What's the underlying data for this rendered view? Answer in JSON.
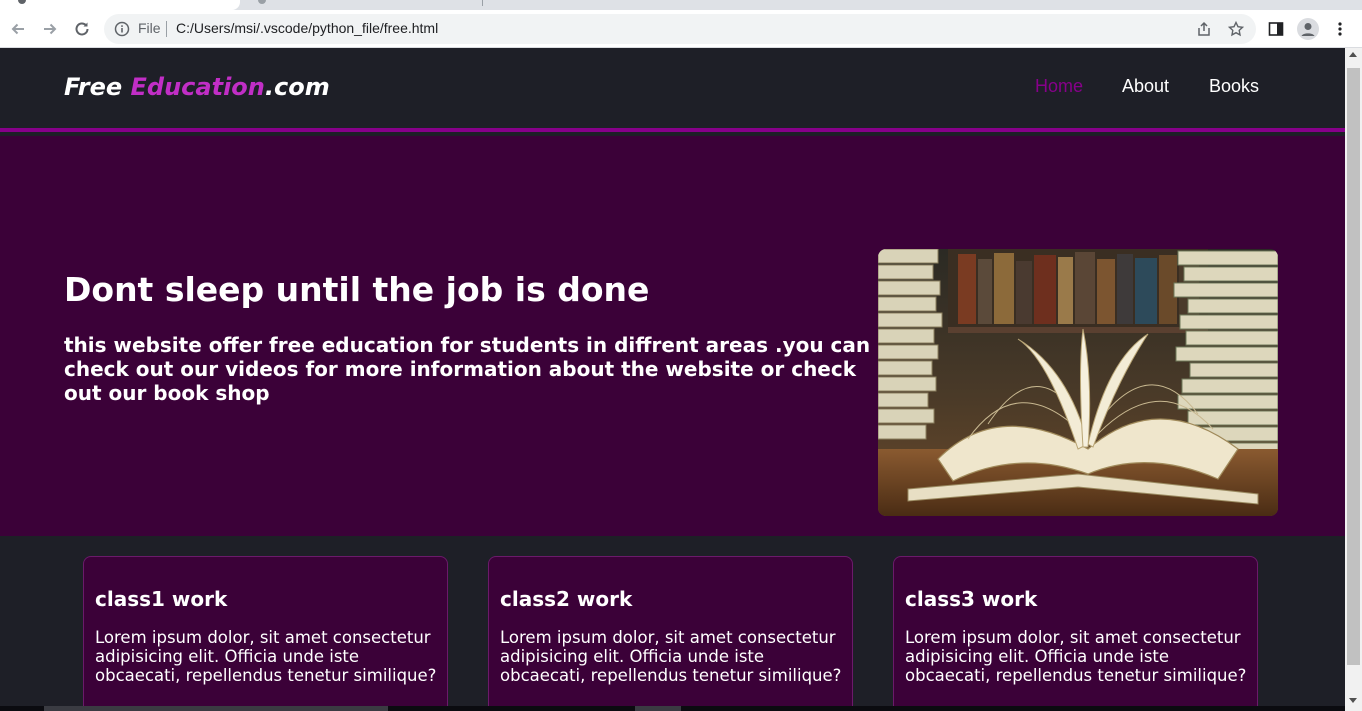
{
  "browser": {
    "address_scheme": "File",
    "address_url": "C:/Users/msi/.vscode/python_file/free.html"
  },
  "site": {
    "logo": {
      "part1": "Free ",
      "part2": "Education",
      "part3": ".com"
    },
    "nav": [
      {
        "label": "Home",
        "active": true
      },
      {
        "label": "About",
        "active": false
      },
      {
        "label": "Books",
        "active": false
      }
    ]
  },
  "hero": {
    "title": "Dont sleep until the job is done",
    "text": "this website offer free education for students in diffrent areas .you can check out our videos for more information about the website or check out our book shop",
    "image": "books-photo"
  },
  "cards": [
    {
      "title": "class1 work",
      "text": "Lorem ipsum dolor, sit amet consectetur adipisicing elit. Officia unde iste obcaecati, repellendus tenetur similique?"
    },
    {
      "title": "class2 work",
      "text": "Lorem ipsum dolor, sit amet consectetur adipisicing elit. Officia unde iste obcaecati, repellendus tenetur similique?"
    },
    {
      "title": "class3 work",
      "text": "Lorem ipsum dolor, sit amet consectetur adipisicing elit. Officia unde iste obcaecati, repellendus tenetur similique?"
    }
  ],
  "colors": {
    "header_bg": "#1e1f27",
    "accent": "#87008a",
    "logo_accent": "#c12ec6",
    "hero_bg": "#3b0138"
  }
}
